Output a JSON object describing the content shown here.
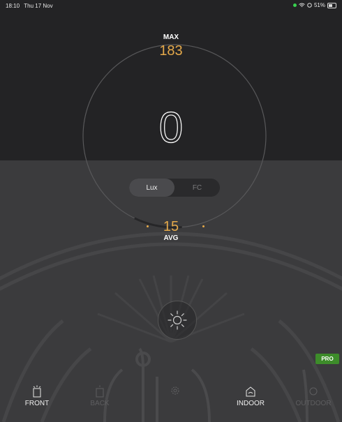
{
  "status_bar": {
    "time": "18:10",
    "date": "Thu 17 Nov",
    "battery": "51%"
  },
  "meter": {
    "max_label": "MAX",
    "max_value": "183",
    "reading": "0",
    "avg_value": "15",
    "avg_label": "AVG",
    "units": {
      "lux": "Lux",
      "fc": "FC",
      "selected": "Lux"
    },
    "accent_color": "#e5a94a"
  },
  "badge": {
    "pro": "PRO"
  },
  "tabs": [
    {
      "label": "FRONT",
      "icon": "front-camera-icon",
      "active": true
    },
    {
      "label": "BACK",
      "icon": "back-camera-icon",
      "active": false
    },
    {
      "label": "",
      "icon": "gear-icon",
      "active": false
    },
    {
      "label": "INDOOR",
      "icon": "house-icon",
      "active": true
    },
    {
      "label": "OUTDOOR",
      "icon": "outdoor-icon",
      "active": false
    }
  ]
}
